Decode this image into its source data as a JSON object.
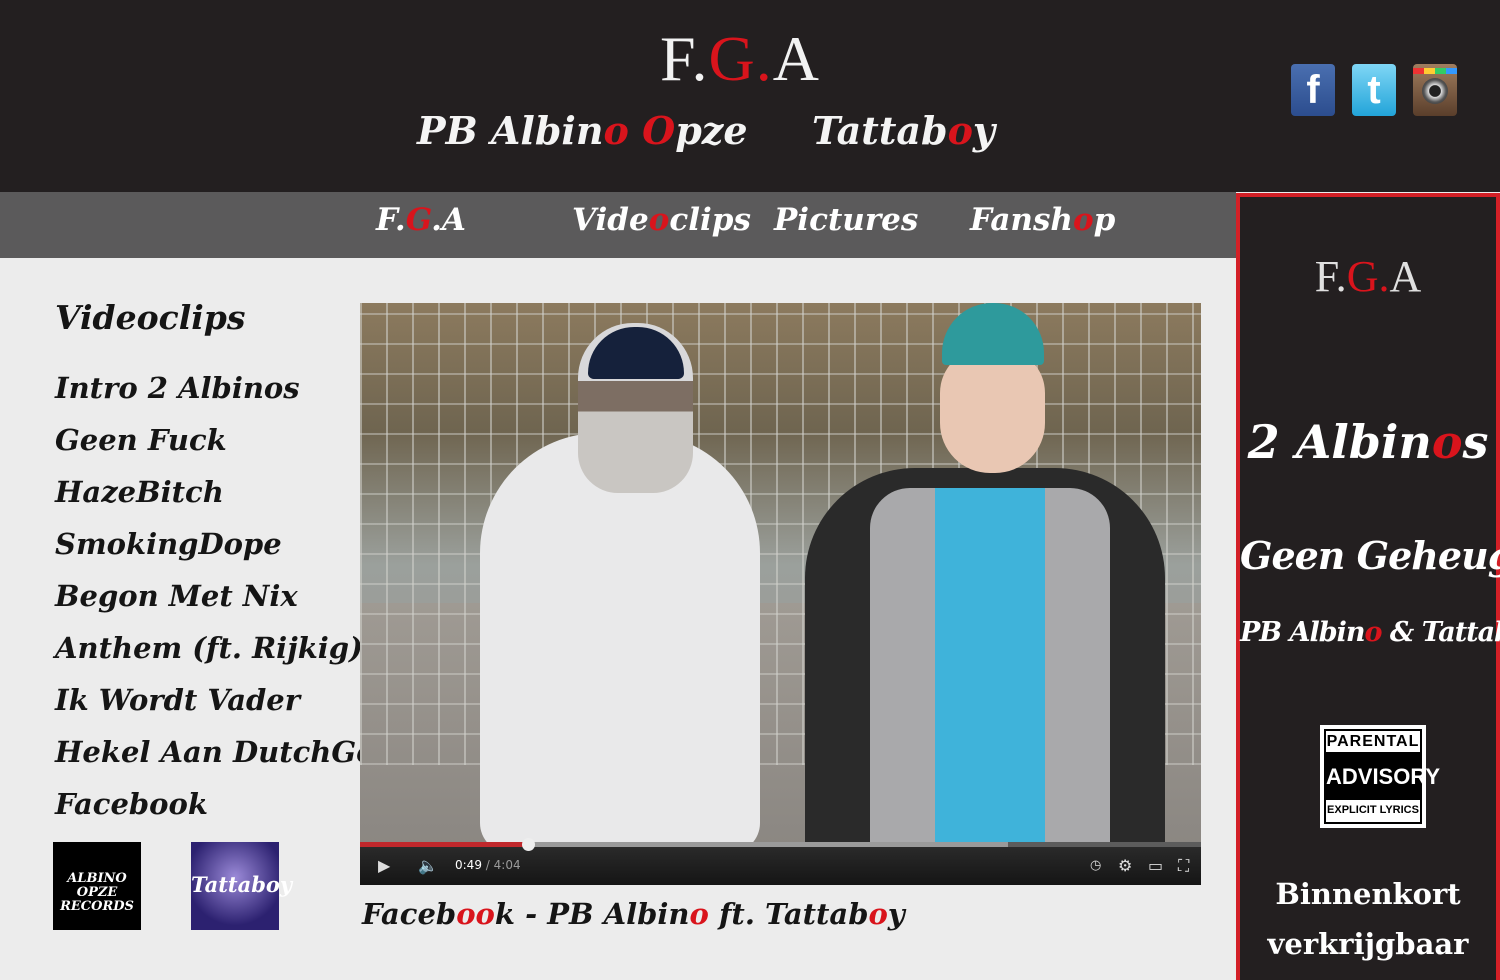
{
  "header": {
    "logo": {
      "a": "F.",
      "b": "G",
      "c": ".",
      "d": "A"
    },
    "artist1": {
      "a": "PB Albin",
      "b": "o",
      "c": " ",
      "d": "O",
      "e": "pze"
    },
    "artist2": {
      "a": "Tattab",
      "b": "o",
      "c": "y"
    },
    "social": {
      "facebook": "facebook-icon",
      "twitter": "twitter-icon",
      "instagram": "instagram-icon"
    }
  },
  "nav": {
    "fga": {
      "a": "F.",
      "b": "G",
      "c": ".A"
    },
    "videoclips": {
      "a": "Vide",
      "b": "o",
      "c": "clips"
    },
    "pictures": "Pictures",
    "fanshop": {
      "a": "Fansh",
      "b": "o",
      "c": "p"
    }
  },
  "sidebar": {
    "title": "Videoclips",
    "clips": [
      "Intro 2  Albinos",
      "Geen Fuck",
      "HazeBitch",
      "SmokingDope",
      "Begon Met Nix",
      "Anthem (ft. Rijkig)",
      "Ik Wordt Vader",
      "Hekel Aan DutchGoon",
      "Facebook"
    ],
    "badges": {
      "albino": {
        "a": "ALBINO OPZE",
        "b": "RECORDS"
      },
      "tattaboy": "Tattaboy"
    }
  },
  "video": {
    "current_time": "0:49",
    "duration": "/ 4:04",
    "progress_played": 0.2,
    "progress_loaded": 0.77,
    "icons": {
      "play": "play-icon",
      "volume": "volume-icon",
      "clock": "clock-icon",
      "settings": "settings-icon",
      "theater": "theater-icon",
      "fullscreen": "fullscreen-icon"
    },
    "caption": {
      "a": "Faceb",
      "b": "oo",
      "c": "k - PB Albin",
      "d": "o",
      "e": " ft. Tattab",
      "f": "o",
      "g": "y"
    }
  },
  "promo": {
    "logo": {
      "a": "F.",
      "b": "G",
      "c": ".",
      "d": "A"
    },
    "line1": {
      "a": "2 Albin",
      "b": "o",
      "c": "s"
    },
    "line2": "Geen Geheugen",
    "line3": {
      "a": "PB Albin",
      "b": "o",
      "c": " & Tattab",
      "d": "o",
      "e": "y"
    },
    "advisory": {
      "top": "PARENTAL",
      "mid": "ADVISORY",
      "bot": "EXPLICIT LYRICS"
    },
    "line4": "Binnenkort verkrijgbaar"
  },
  "colors": {
    "accent": "#d9141c",
    "header_bg": "#231f20",
    "nav_bg": "#5b5a5b",
    "page_bg": "#ececec"
  }
}
